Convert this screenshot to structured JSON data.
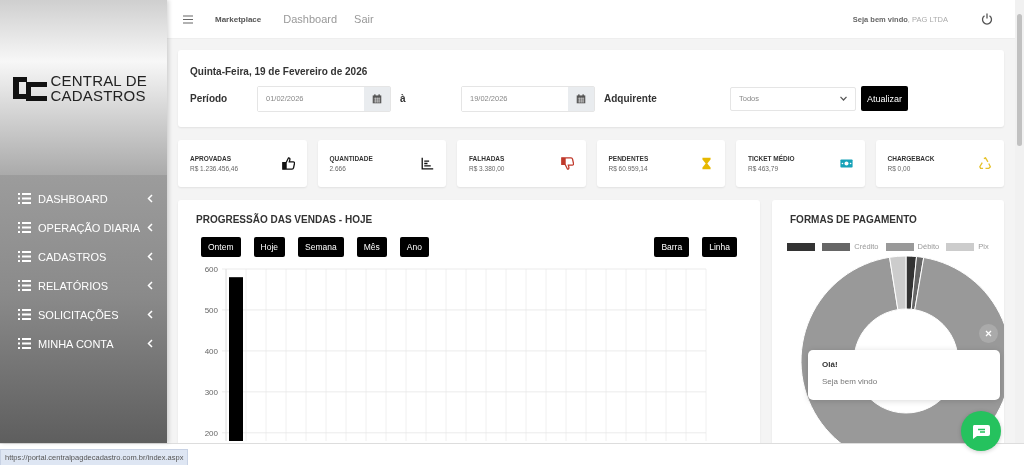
{
  "sidebar": {
    "logo_text": "CENTRAL DE CADASTROS",
    "items": [
      {
        "label": "DASHBOARD"
      },
      {
        "label": "OPERAÇÃO DIARIA"
      },
      {
        "label": "CADASTROS"
      },
      {
        "label": "RELATÓRIOS"
      },
      {
        "label": "SOLICITAÇÕES"
      },
      {
        "label": "MINHA CONTA"
      }
    ]
  },
  "navbar": {
    "brand": "Marketplace",
    "links": [
      "Dashboard",
      "Sair"
    ],
    "welcome": "**Seja bem vindo**, PAG LTDA"
  },
  "filter": {
    "date": "Quinta-Feira, 19 de Fevereiro de 2026",
    "period_label": "Período",
    "start_date": "01/02/2026",
    "separator": "à",
    "end_date": "19/02/2026",
    "acquirer_label": "Adquirente",
    "acquirer_value": "Todos",
    "submit": "Atualizar"
  },
  "stats": [
    {
      "label": "APROVADAS",
      "value": "R$ 1.236.456,46"
    },
    {
      "label": "QUANTIDADE",
      "value": "2.666"
    },
    {
      "label": "FALHADAS",
      "value": "R$ 3.380,00"
    },
    {
      "label": "PENDENTES",
      "value": "R$ 60.959,14"
    },
    {
      "label": "TICKET MÉDIO",
      "value": "R$ 463,79"
    },
    {
      "label": "CHARGEBACK",
      "value": "R$ 0,00"
    }
  ],
  "sales_chart": {
    "title": "PROGRESSÃO DAS VENDAS - HOJE",
    "period_buttons": [
      "Ontem",
      "Hoje",
      "Semana",
      "Mês",
      "Ano"
    ],
    "type_buttons": [
      "Barra",
      "Linha"
    ],
    "chart_data": {
      "type": "bar",
      "values": [
        580,
        null,
        null,
        null,
        null,
        null,
        null,
        null,
        null,
        null,
        null,
        null,
        null,
        null,
        null,
        null,
        null,
        null,
        null,
        null,
        null,
        null,
        null,
        null
      ],
      "ylim": [
        180,
        600
      ],
      "grid": true,
      "yticks": [
        200,
        300,
        400,
        500,
        600
      ]
    }
  },
  "payment_chart": {
    "title": "FORMAS DE PAGAMENTO",
    "legend": [
      {
        "color": "#333333"
      },
      {
        "label": "Crédito",
        "color": "#666666"
      },
      {
        "label": "Débito",
        "color": "#999999"
      },
      {
        "label": "Pix",
        "color": "#cccccc"
      }
    ]
  },
  "chat": {
    "title": "Olá!",
    "message": "Seja bem vindo"
  },
  "status_url": "https://portal.centralpagdecadastro.com.br/index.aspx"
}
